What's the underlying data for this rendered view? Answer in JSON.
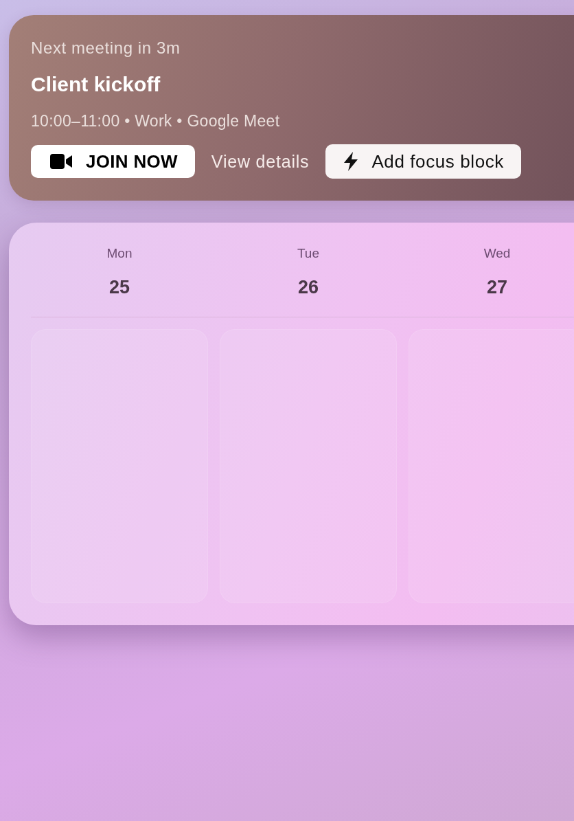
{
  "next_meeting": {
    "countdown": "Next meeting in 3m",
    "title": "Client kickoff",
    "details": "10:00–11:00 • Work • Google Meet",
    "actions": [
      {
        "kind": "primary",
        "label": "JOIN NOW"
      },
      {
        "kind": "link",
        "label": "View details"
      },
      {
        "kind": "secondary",
        "label": "Add focus block"
      }
    ]
  },
  "week": {
    "days": [
      {
        "weekday": "Mon",
        "date": "25"
      },
      {
        "weekday": "Tue",
        "date": "26"
      },
      {
        "weekday": "Wed",
        "date": "27"
      }
    ]
  }
}
